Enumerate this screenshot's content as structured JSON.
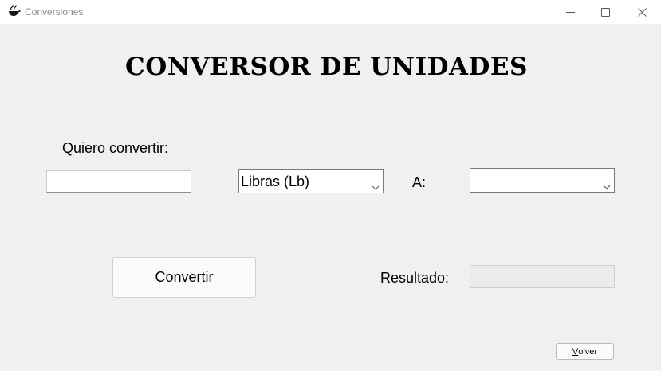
{
  "window": {
    "title": "Conversiones",
    "icon": "pan-with-steam-icon"
  },
  "titlebar_buttons": {
    "minimize": "minimize-icon",
    "maximize": "maximize-icon",
    "close": "close-icon"
  },
  "main": {
    "heading": "CONVERSOR DE UNIDADES",
    "quiero_label": "Quiero convertir:",
    "input_value": "",
    "from_unit": {
      "selected": "Libras (Lb)"
    },
    "to_label": "A:",
    "to_unit": {
      "selected": ""
    },
    "convert_button": "Convertir",
    "result_label": "Resultado:",
    "result_value": ""
  },
  "footer": {
    "back_button_first": "V",
    "back_button_rest": "olver"
  }
}
